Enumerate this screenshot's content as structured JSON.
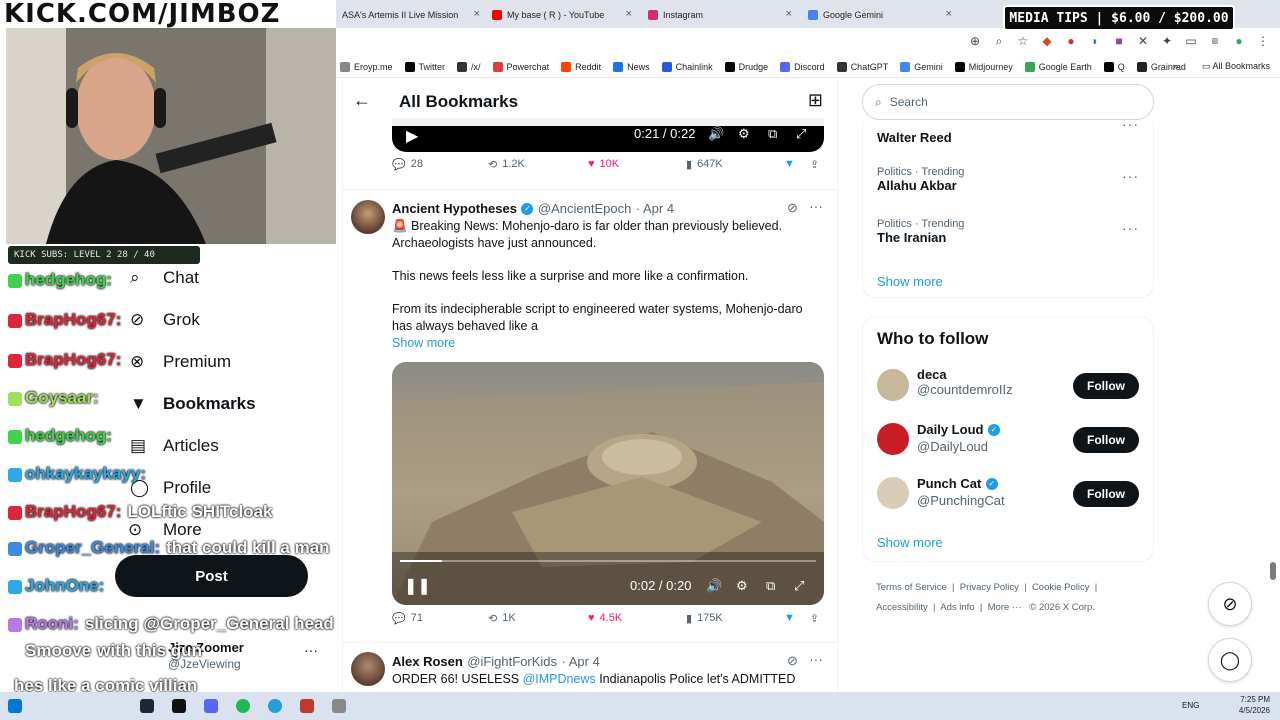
{
  "overlay": {
    "kick_banner": "KICK.COM/JIMBOZ",
    "subs_bar": "KICK SUBS: LEVEL 2 28 / 40",
    "media_tips": "MEDIA TIPS | $6.00 / $200.00",
    "chat": [
      {
        "user": "hedgehog",
        "sep": ":",
        "msg": "",
        "color": "#3fd24a"
      },
      {
        "user": "BrapHog67",
        "sep": ":",
        "msg": "",
        "color": "#e0243a"
      },
      {
        "user": "BrapHog67",
        "sep": ":",
        "msg": "",
        "color": "#e0243a"
      },
      {
        "user": "Goysaar",
        "sep": ":",
        "msg": "",
        "color": "#9de05a"
      },
      {
        "user": "hedgehog",
        "sep": ":",
        "msg": "",
        "color": "#3fd24a"
      },
      {
        "user": "ohkaykaykayy",
        "sep": ":",
        "msg": "",
        "color": "#2fa8e8"
      },
      {
        "user": "BrapHog67",
        "sep": ":",
        "msg": "LOLftic SHITcloak",
        "color": "#e0243a"
      },
      {
        "user": "Groper_General",
        "sep": ":",
        "msg": "that could kill a man",
        "color": "#3f8ae0"
      },
      {
        "user": "JohnOne",
        "sep": ":",
        "msg": "",
        "color": "#2fa8e8"
      },
      {
        "user": "Rooni",
        "sep": ":",
        "msg": "slicing @Groper_General head",
        "color": "#b37ae8"
      },
      {
        "user": "Smoove",
        "sep": "",
        "msg": "with this gun",
        "color": "#ffffff"
      },
      {
        "user": "",
        "sep": "",
        "msg": "hes like a comic villian",
        "color": "#ffffff"
      }
    ]
  },
  "browser": {
    "tabs": [
      {
        "label": "ASA's Artemis II Live Mission",
        "color": "#ffffff"
      },
      {
        "label": "My base ( R ) - YouTube",
        "color": "#ff0000"
      },
      {
        "label": "Instagram",
        "color": "#d62976"
      },
      {
        "label": "Google Gemini",
        "color": "#4285f4"
      }
    ],
    "new_tab": "+",
    "bookmarks": [
      {
        "label": "Eroyp.me",
        "color": "#888888"
      },
      {
        "label": "Twitter",
        "color": "#000000"
      },
      {
        "label": "/x/",
        "color": "#333333"
      },
      {
        "label": "Powerchat",
        "color": "#e23b3b"
      },
      {
        "label": "Reddit",
        "color": "#ff4500"
      },
      {
        "label": "News",
        "color": "#1a73e8"
      },
      {
        "label": "Chainlink",
        "color": "#2a5ada"
      },
      {
        "label": "Drudge",
        "color": "#000000"
      },
      {
        "label": "Discord",
        "color": "#5865f2"
      },
      {
        "label": "ChatGPT",
        "color": "#333333"
      },
      {
        "label": "Gemini",
        "color": "#4285f4"
      },
      {
        "label": "Midjourney",
        "color": "#000000"
      },
      {
        "label": "Google Earth",
        "color": "#34a853"
      },
      {
        "label": "Q",
        "color": "#000000"
      },
      {
        "label": "Grainrad",
        "color": "#222222"
      }
    ],
    "all_bookmarks": "All Bookmarks"
  },
  "nav": {
    "items": [
      "Chat",
      "Grok",
      "Premium",
      "Bookmarks",
      "Articles",
      "Profile",
      "More"
    ],
    "post_button": "Post",
    "account_name": "Jize Zoomer",
    "account_handle": "@JzeViewing"
  },
  "feed": {
    "title": "All Bookmarks",
    "video1": {
      "time": "0:21 / 0:22",
      "progress": 0.95
    },
    "stats1": {
      "replies": "28",
      "reposts": "1.2K",
      "likes": "10K",
      "views": "647K"
    },
    "tweet2": {
      "name": "Ancient Hypotheses",
      "handle": "@AncientEpoch",
      "date": "· Apr 4",
      "p1": "🚨 Breaking News: Mohenjo-daro is far older than previously believed. Archaeologists have just announced.",
      "p2": "This news feels less like a surprise and more like a confirmation.",
      "p3": "From its indecipherable script to engineered water systems, Mohenjo-daro has always behaved like a",
      "show_more": "Show more",
      "video_time": "0:02 / 0:20",
      "progress": 0.1
    },
    "stats2": {
      "replies": "71",
      "reposts": "1K",
      "likes": "4.5K",
      "views": "175K"
    },
    "tweet3": {
      "name": "Alex Rosen",
      "handle": "@iFightForKids",
      "date": "· Apr 4",
      "text_a": "ORDER 66! USELESS ",
      "mention": "@IMPDnews",
      "text_b": " Indianapolis Police let's ADMITTED"
    }
  },
  "right": {
    "search_placeholder": "Search",
    "trends": [
      {
        "meta": "",
        "name": "Walter Reed"
      },
      {
        "meta": "Politics · Trending",
        "name": "Allahu Akbar"
      },
      {
        "meta": "Politics · Trending",
        "name": "The Iranian"
      }
    ],
    "trends_show_more": "Show more",
    "who_to_follow": "Who to follow",
    "follow": [
      {
        "name": "deca",
        "handle": "@countdemroIIz",
        "verified": false,
        "avatar": "#c9b79a"
      },
      {
        "name": "Daily Loud",
        "handle": "@DailyLoud",
        "verified": true,
        "avatar": "#c81d25"
      },
      {
        "name": "Punch Cat",
        "handle": "@PunchingCat",
        "verified": true,
        "avatar": "#d8cbb8"
      }
    ],
    "follow_label": "Follow",
    "follow_show_more": "Show more",
    "footer": {
      "links1": [
        "Terms of Service",
        "Privacy Policy",
        "Cookie Policy"
      ],
      "links2": [
        "Accessibility",
        "Ads info",
        "More ···"
      ],
      "copyright": "© 2026 X Corp."
    }
  },
  "taskbar": {
    "lang": "ENG",
    "time": "7:25 PM",
    "date": "4/5/2026"
  }
}
